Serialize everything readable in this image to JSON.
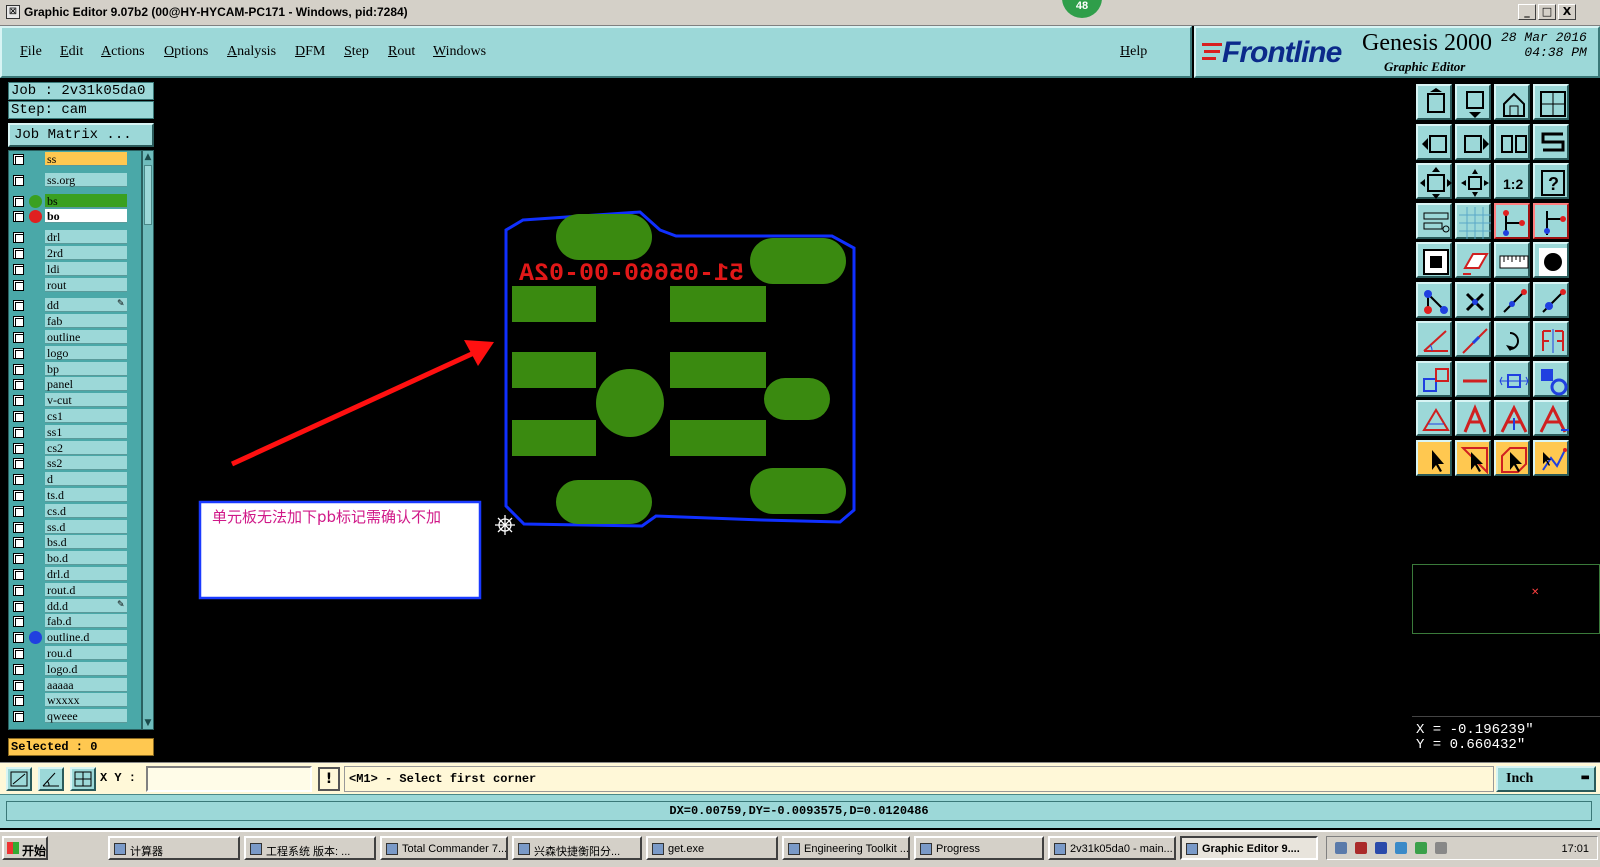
{
  "window": {
    "title": "Graphic Editor 9.07b2 (00@HY-HYCAM-PC171 - Windows, pid:7284)",
    "badge": "48",
    "controls": [
      "_",
      "□",
      "X"
    ]
  },
  "menu": {
    "items": [
      "File",
      "Edit",
      "Actions",
      "Options",
      "Analysis",
      "DFM",
      "Step",
      "Rout",
      "Windows"
    ],
    "help": "Help"
  },
  "brand": {
    "logo": "Frontline",
    "product": "Genesis 2000",
    "subtitle": "Graphic Editor",
    "date": "28 Mar 2016",
    "time": "04:38 PM"
  },
  "job": {
    "job_line": "Job : 2v31k05da0",
    "step_line": "Step: cam",
    "matrix_button": "Job Matrix ..."
  },
  "layers": [
    {
      "name": "ss",
      "highlight": "#ffc850"
    },
    {
      "name": "ss.org"
    },
    {
      "name": "bs",
      "dot": "#3aa020",
      "highlight": "#3aa020"
    },
    {
      "name": "bo",
      "dot": "#e02020",
      "highlight": "#ffffff",
      "active": true
    },
    {
      "name": "drl"
    },
    {
      "name": "2rd"
    },
    {
      "name": "ldi"
    },
    {
      "name": "rout"
    },
    {
      "name": "dd",
      "mark": "✎"
    },
    {
      "name": "fab"
    },
    {
      "name": "outline"
    },
    {
      "name": "logo"
    },
    {
      "name": "bp"
    },
    {
      "name": "panel"
    },
    {
      "name": "v-cut"
    },
    {
      "name": "cs1"
    },
    {
      "name": "ss1"
    },
    {
      "name": "cs2"
    },
    {
      "name": "ss2"
    },
    {
      "name": "d"
    },
    {
      "name": "ts.d"
    },
    {
      "name": "cs.d"
    },
    {
      "name": "ss.d"
    },
    {
      "name": "bs.d"
    },
    {
      "name": "bo.d"
    },
    {
      "name": "drl.d"
    },
    {
      "name": "rout.d"
    },
    {
      "name": "dd.d",
      "mark": "✎"
    },
    {
      "name": "fab.d"
    },
    {
      "name": "outline.d",
      "dot": "#2040e0"
    },
    {
      "name": "rou.d"
    },
    {
      "name": "logo.d"
    },
    {
      "name": "aaaaa"
    },
    {
      "name": "wxxxx"
    },
    {
      "name": "qweee"
    }
  ],
  "selected": "Selected : 0",
  "canvas": {
    "board_text": "51-05660-00-02A",
    "annotation": "单元板无法加下pb标记需确认不加",
    "colors": {
      "outline": "#1030ff",
      "pads": "#3a8a10",
      "text": "#e01818",
      "arrow": "#ff1010",
      "annotation_text": "#d01888"
    }
  },
  "toolbar_icons": [
    "move-up-icon",
    "move-down-icon",
    "home-icon",
    "window-icon",
    "move-left-icon",
    "move-right-icon",
    "zoom-fit-icon",
    "step-icon",
    "zoom-extents-icon",
    "zoom-center-icon",
    "scale-icon",
    "help-icon",
    "comment-icon",
    "grid-icon",
    "net-icon",
    "net-red-icon",
    "snap-icon",
    "layer-edit-icon",
    "ruler-icon",
    "pad-icon",
    "connect-icon",
    "cross-icon",
    "point-icon",
    "points-icon",
    "angle-icon",
    "line-icon",
    "undo-arc-icon",
    "flip-icon",
    "copy-icon",
    "minus-icon",
    "resize-icon",
    "group-icon",
    "triangle-icon",
    "text-icon",
    "text-up-icon",
    "text-plus-icon",
    "select-icon",
    "select-box-icon",
    "select-rotate-icon",
    "select-net-icon"
  ],
  "coords": {
    "x": "X = -0.196239\"",
    "y": "Y = 0.660432\""
  },
  "command": {
    "xy_label": "X Y :",
    "xy_value": "",
    "bang": "!",
    "prompt": "<M1> - Select first corner",
    "units": "Inch"
  },
  "status": "DX=0.00759,DY=-0.0093575,D=0.0120486",
  "taskbar": {
    "start": "开始",
    "tasks": [
      "计算器",
      "工程系统 版本: ...",
      "Total Commander 7...",
      "兴森快捷衡阳分...",
      "get.exe",
      "Engineering Toolkit ...",
      "Progress",
      "2v31k05da0 - main...",
      "Graphic Editor 9...."
    ],
    "clock": "17:01"
  }
}
